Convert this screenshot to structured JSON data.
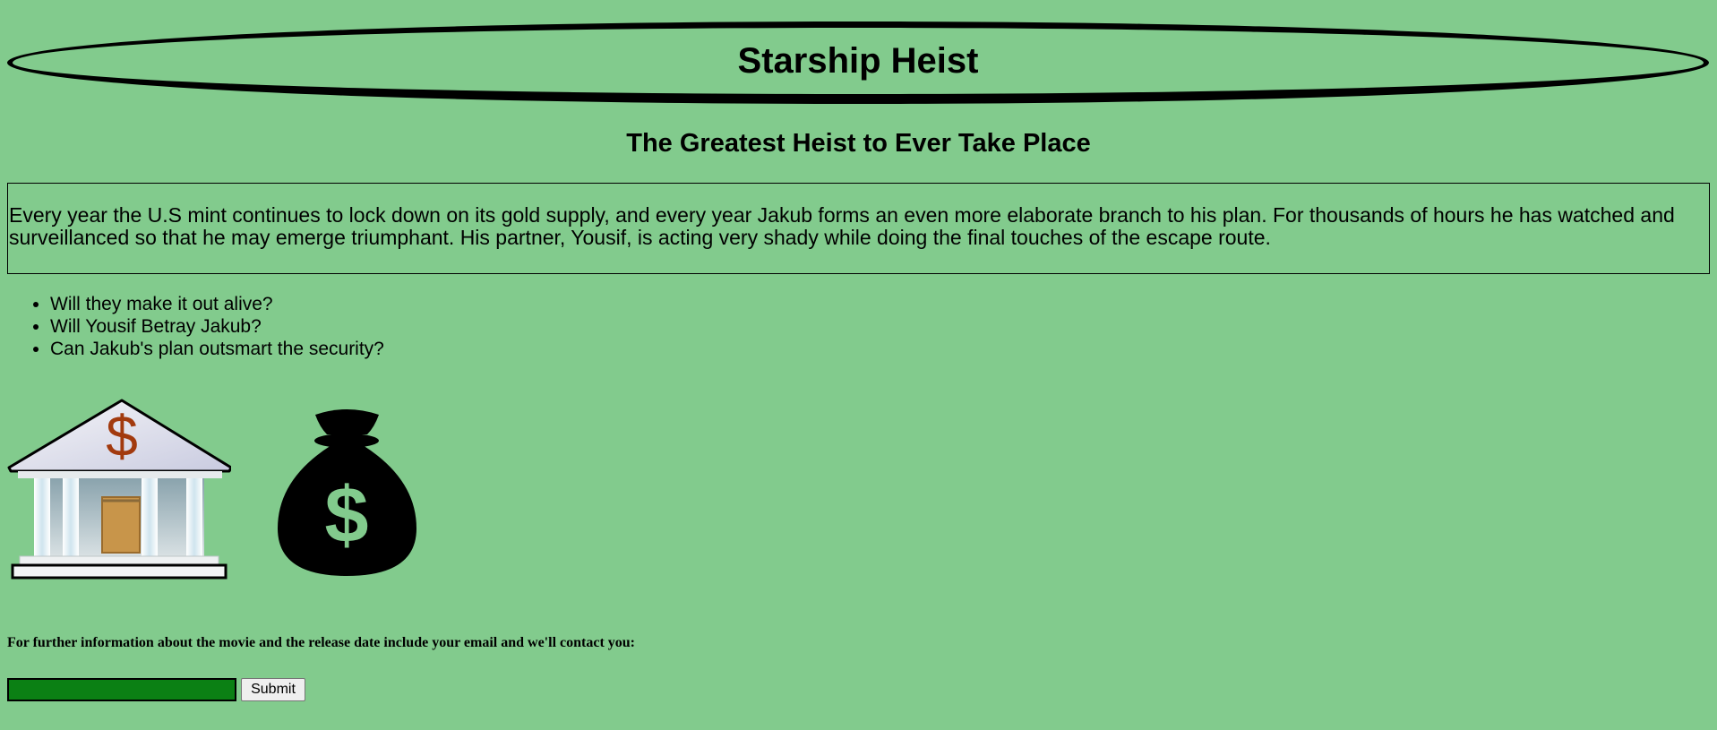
{
  "header": {
    "title": "Starship Heist",
    "subtitle": "The Greatest Heist to Ever Take Place"
  },
  "story": {
    "paragraph": "Every year the U.S mint continues to lock down on its gold supply, and every year Jakub forms an even more elaborate branch to his plan. For thousands of hours he has watched and surveillanced so that he may emerge triumphant. His partner, Yousif, is acting very shady while doing the final touches of the escape route."
  },
  "questions": [
    "Will they make it out alive?",
    "Will Yousif Betray Jakub?",
    "Can Jakub's plan outsmart the security?"
  ],
  "images": {
    "bank_icon": "bank-icon",
    "money_bag_icon": "money-bag-icon"
  },
  "contact": {
    "prompt": "For further information about the movie and the release date include your email and we'll contact you:",
    "email_value": "",
    "submit_label": "Submit"
  },
  "colors": {
    "background": "#82cb8d",
    "input_fill": "#0b8014",
    "dollar_sign": "#a23a0e",
    "door": "#c8954a"
  }
}
